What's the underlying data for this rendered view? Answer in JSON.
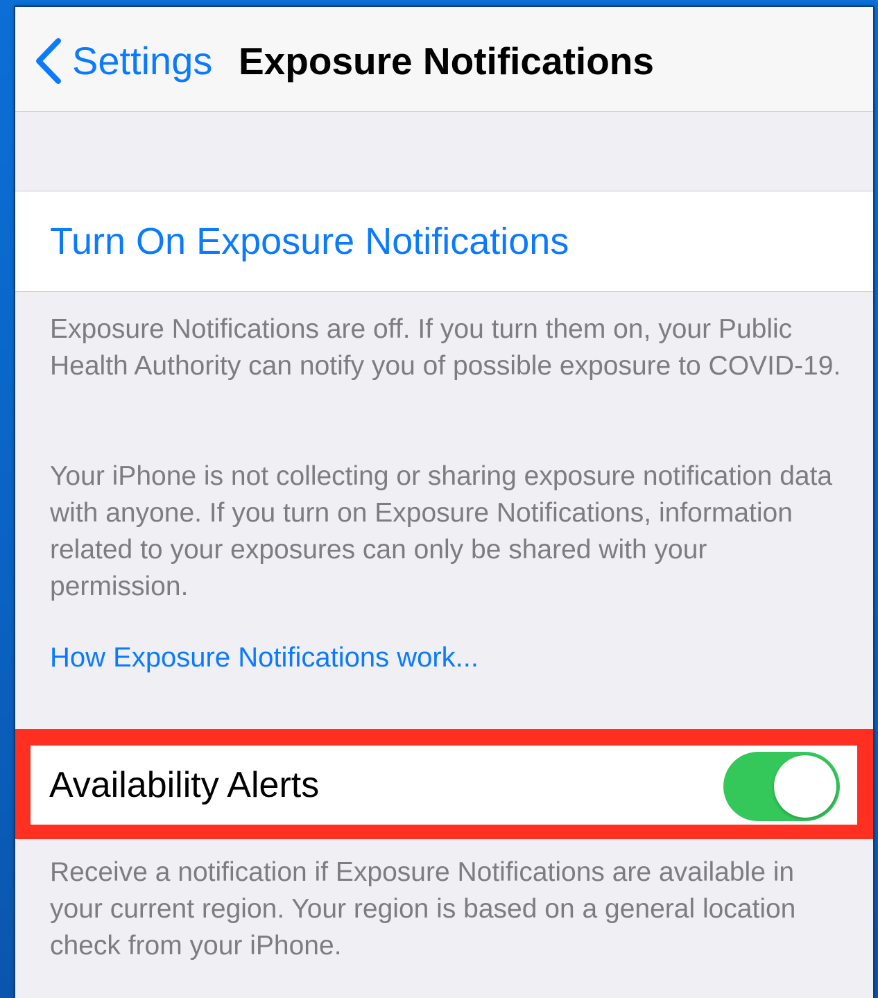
{
  "navbar": {
    "back_label": "Settings",
    "title": "Exposure Notifications"
  },
  "turn_on": {
    "label": "Turn On Exposure Notifications"
  },
  "info": {
    "status_text": "Exposure Notifications are off. If you turn them on, your Public Health Authority can notify you of possible exposure to COVID-19.",
    "privacy_text": "Your iPhone is not collecting or sharing exposure notification data with anyone. If you turn on Exposure Notifications, information related to your exposures can only be shared with your permission.",
    "how_link": "How Exposure Notifications work..."
  },
  "availability": {
    "label": "Availability Alerts",
    "enabled": true,
    "description": "Receive a notification if Exposure Notifications are available in your current region. Your region is based on a general location check from your iPhone."
  },
  "colors": {
    "accent": "#0a7aff",
    "toggle_on": "#34c759",
    "highlight": "#ff2f21",
    "background": "#efeff4"
  },
  "icons": {
    "back": "chevron-left-icon"
  }
}
